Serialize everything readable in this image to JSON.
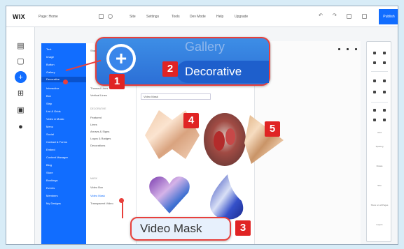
{
  "topbar": {
    "logo": "WIX",
    "page_label": "Page: Home",
    "menus": [
      "Site",
      "Settings",
      "Tools",
      "Dev Mode",
      "Help",
      "Upgrade"
    ],
    "publish_label": "Publish"
  },
  "rail": {
    "icons": [
      "pages-icon",
      "layers-icon",
      "add-icon",
      "apps-icon",
      "media-icon",
      "blog-icon"
    ]
  },
  "categories": {
    "items": [
      "Text",
      "Image",
      "Button",
      "Gallery",
      "Decorative",
      "Interactive",
      "Box",
      "Strip",
      "List & Grids",
      "Video & Music",
      "Menu",
      "Social",
      "Contact & Forms",
      "Embed",
      "Content Manager",
      "Blog",
      "Store",
      "Bookings",
      "Events",
      "Members",
      "My Designs"
    ],
    "selected": "Decorative"
  },
  "submenu": {
    "items_top": [
      "Shapes",
      "Themed Lines",
      "Vertical Lines"
    ],
    "section_label": "DECORATIVE",
    "items_mid": [
      "Featured",
      "Lines",
      "Arrows & Signs",
      "Logos & Badges",
      "Decorations"
    ],
    "section_label_2": "MASK",
    "items_bottom": [
      "Video Box",
      "Video Mask",
      "Transparent Video"
    ],
    "selected": "Video Mask"
  },
  "content": {
    "search_label": "Video Mask"
  },
  "callouts": {
    "faded_title": "Gallery",
    "decorative": "Decorative",
    "video_mask": "Video Mask",
    "badges": [
      "1",
      "2",
      "3",
      "4",
      "5"
    ]
  },
  "tools": {
    "labels": [
      "Grid",
      "Spacing",
      "Rotate",
      "Size",
      "Show on all Pages",
      "Layers"
    ]
  }
}
